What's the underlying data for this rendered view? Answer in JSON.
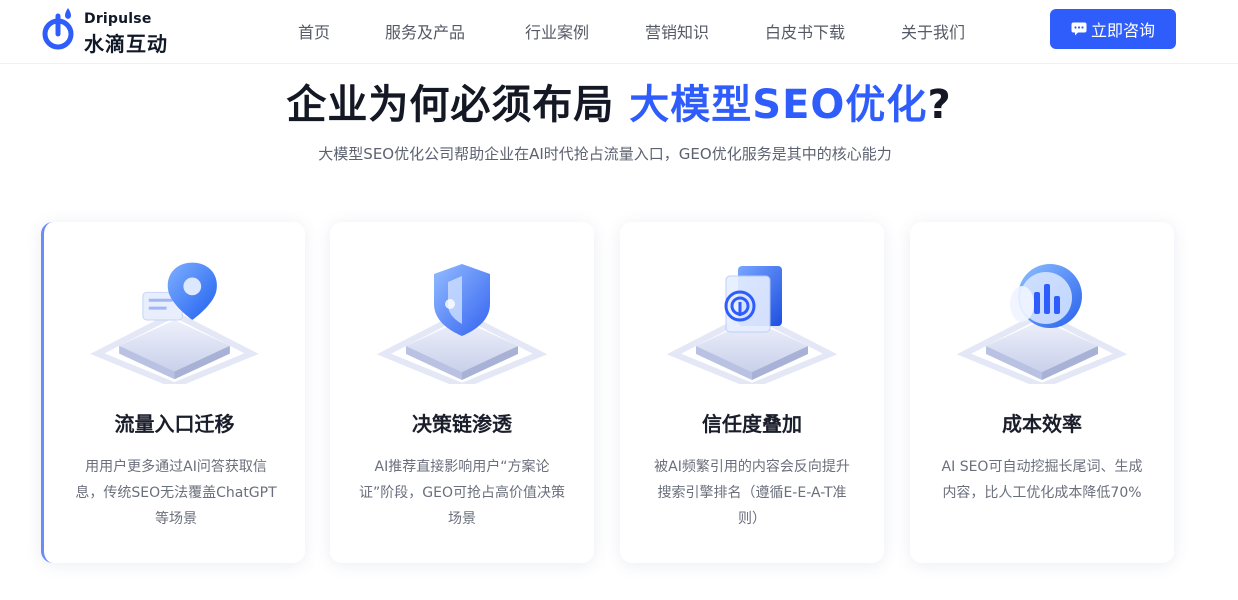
{
  "header": {
    "logo": {
      "en": "Dripulse",
      "cn": "水滴互动",
      "icon": "water-drop-logo-icon"
    },
    "nav": [
      "首页",
      "服务及产品",
      "行业案例",
      "营销知识",
      "白皮书下载",
      "关于我们"
    ],
    "cta": {
      "label": "立即咨询",
      "icon": "chat-icon"
    }
  },
  "hero": {
    "title_main": "企业为何必须布局",
    "title_accent": "大模型SEO优化",
    "title_end": "?",
    "subtitle": "大模型SEO优化公司帮助企业在AI时代抢占流量入口，GEO优化服务是其中的核心能力"
  },
  "colors": {
    "accent": "#2f5dfb",
    "card_active_border": "#6b8bf5"
  },
  "cards": [
    {
      "icon": "location-pin-icon",
      "title": "流量入口迁移",
      "desc": "用用户更多通过AI问答获取信息，传统SEO无法覆盖ChatGPT等场景"
    },
    {
      "icon": "shield-icon",
      "title": "决策链渗透",
      "desc": "AI推荐直接影响用户“方案论证”阶段，GEO可抢占高价值决策场景"
    },
    {
      "icon": "fingerprint-icon",
      "title": "信任度叠加",
      "desc": "被AI频繁引用的内容会反向提升搜索引擎排名（遵循E-E-A-T准则）"
    },
    {
      "icon": "chart-disc-icon",
      "title": "成本效率",
      "desc": "AI SEO可自动挖掘长尾词、生成内容，比人工优化成本降低70%"
    }
  ]
}
